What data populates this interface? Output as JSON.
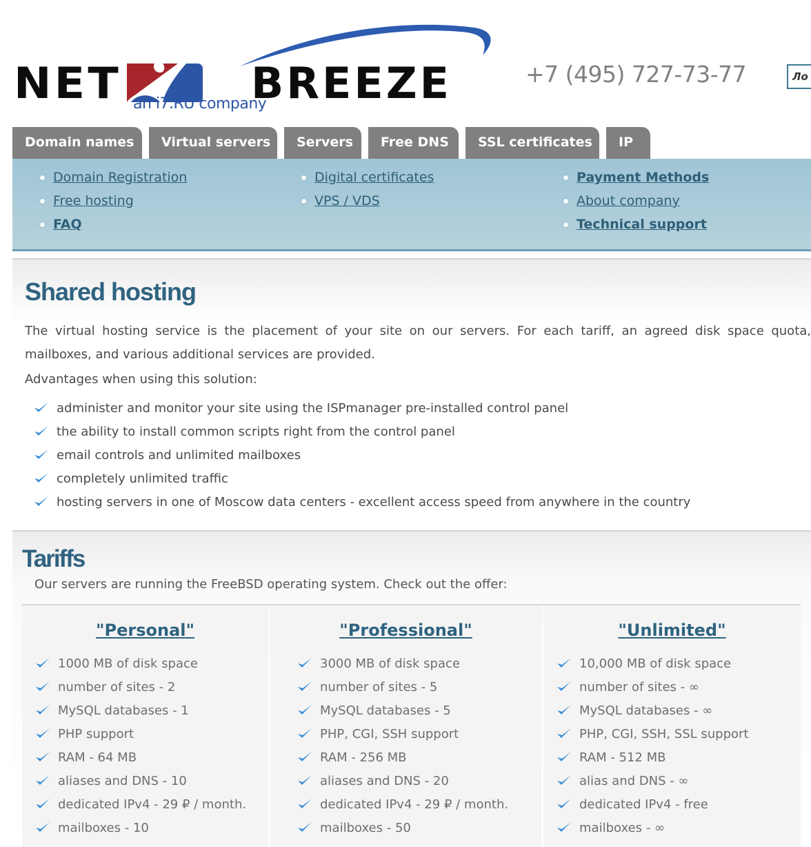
{
  "header": {
    "logo": {
      "word_left": "NET",
      "word_right": "BREEZE",
      "subtitle": "an i7.RU company",
      "colors": {
        "red": "#a6262b",
        "blue": "#2d55a5",
        "black": "#0c0c0c"
      }
    },
    "phone": "+7 (495) 727-73-77",
    "login_label": "Ло"
  },
  "tabs": [
    {
      "label": "Domain names"
    },
    {
      "label": "Virtual servers"
    },
    {
      "label": "Servers"
    },
    {
      "label": "Free DNS"
    },
    {
      "label": "SSL certificates"
    },
    {
      "label": "IP"
    }
  ],
  "submenu": {
    "columns": [
      [
        {
          "label": "Domain Registration",
          "bold": false
        },
        {
          "label": "Free hosting",
          "bold": false
        },
        {
          "label": "FAQ",
          "bold": true
        }
      ],
      [
        {
          "label": "Digital certificates",
          "bold": false
        },
        {
          "label": "VPS / VDS",
          "bold": false
        }
      ],
      [
        {
          "label": "Payment Methods",
          "bold": true
        },
        {
          "label": "About company",
          "bold": false
        },
        {
          "label": "Technical support",
          "bold": true
        }
      ]
    ]
  },
  "shared_hosting": {
    "title": "Shared hosting",
    "description": "The virtual hosting service is the placement of your site on our servers. For each tariff, an agreed disk space quota, mailboxes, and various additional services are provided.",
    "advantages_title": "Advantages when using this solution:",
    "advantages": [
      "administer and monitor your site using the ISPmanager pre-installed control panel",
      "the ability to install common scripts right from the control panel",
      "email controls and unlimited mailboxes",
      "completely unlimited traffic",
      "hosting servers in one of Moscow data centers - excellent access speed from anywhere in the country"
    ]
  },
  "tariffs": {
    "title": "Tariffs",
    "subtitle": "Our servers are running the FreeBSD operating system. Check out the offer:",
    "plans": [
      {
        "name": "\"Personal\"",
        "features": [
          "1000 MB of disk space",
          "number of sites - 2",
          "MySQL databases - 1",
          "PHP support",
          "RAM - 64 MB",
          "aliases and DNS - 10",
          "dedicated IPv4 - 29 ₽ / month.",
          "mailboxes - 10"
        ]
      },
      {
        "name": "\"Professional\"",
        "features": [
          "3000 MB of disk space",
          "number of sites - 5",
          "MySQL databases - 5",
          "PHP, CGI, SSH support",
          "RAM - 256 MB",
          "aliases and DNS - 20",
          "dedicated IPv4 - 29 ₽ / month.",
          "mailboxes - 50"
        ]
      },
      {
        "name": "\"Unlimited\"",
        "features": [
          "10,000 MB of disk space",
          "number of sites - ∞",
          "MySQL databases - ∞",
          "PHP, CGI, SSH, SSL support",
          "RAM - 512 MB",
          "alias and DNS - ∞",
          "dedicated IPv4 - free",
          "mailboxes - ∞"
        ]
      }
    ]
  },
  "icons": {
    "check": "checkmark-icon",
    "bullet": "bullet-icon"
  },
  "colors": {
    "heading": "#2f6380",
    "link": "#2f5f78",
    "tab_bg": "#808080",
    "submenu_bg": "#a9cbd9",
    "check": "#3a8fd8"
  }
}
